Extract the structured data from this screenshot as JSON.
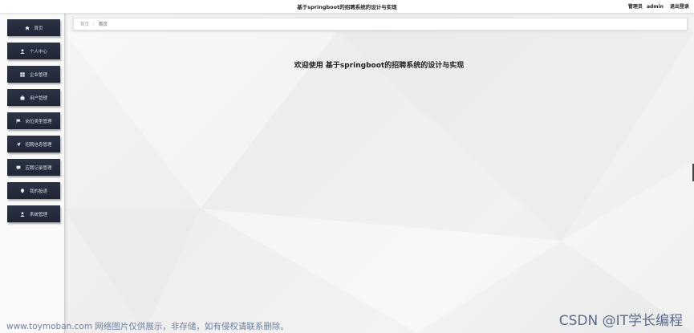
{
  "header": {
    "title": "基于springboot的招聘系统的设计与实现",
    "user_role": "管理员",
    "username": "admin",
    "logout_label": "退出登录"
  },
  "sidebar": {
    "items": [
      {
        "label": "首页",
        "icon": "home-icon"
      },
      {
        "label": "个人中心",
        "icon": "user-icon"
      },
      {
        "label": "企业管理",
        "icon": "grid-icon"
      },
      {
        "label": "用户管理",
        "icon": "briefcase-icon"
      },
      {
        "label": "岗位类型管理",
        "icon": "flag-icon"
      },
      {
        "label": "招聘信息管理",
        "icon": "send-icon"
      },
      {
        "label": "应聘记录管理",
        "icon": "chat-icon"
      },
      {
        "label": "我的投递",
        "icon": "location-pin-icon"
      },
      {
        "label": "系统管理",
        "icon": "user-icon"
      }
    ]
  },
  "breadcrumb": {
    "root": "首页",
    "current": "首页"
  },
  "main": {
    "welcome": "欢迎使用 基于springboot的招聘系统的设计与实现"
  },
  "watermark": {
    "left": "www.toymoban.com 网络图片仅供展示，非存储，如有侵权请联系删除。",
    "right": "CSDN @IT学长编程"
  },
  "colors": {
    "menu_bg": "#252b3b",
    "menu_text": "#d8dce6",
    "watermark": "#6e7fa0"
  }
}
